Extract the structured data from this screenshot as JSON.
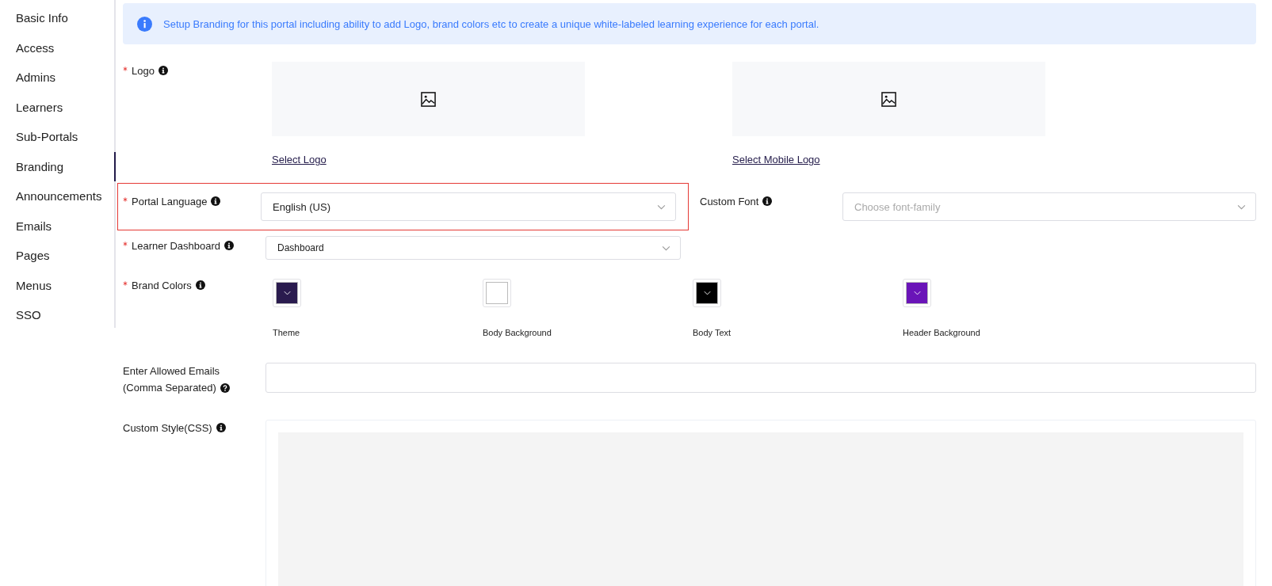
{
  "sidebar": {
    "items": [
      {
        "label": "Basic Info",
        "selected": false
      },
      {
        "label": "Access",
        "selected": false
      },
      {
        "label": "Admins",
        "selected": false
      },
      {
        "label": "Learners",
        "selected": false
      },
      {
        "label": "Sub-Portals",
        "selected": false
      },
      {
        "label": "Branding",
        "selected": true
      },
      {
        "label": "Announcements",
        "selected": false
      },
      {
        "label": "Emails",
        "selected": false
      },
      {
        "label": "Pages",
        "selected": false
      },
      {
        "label": "Menus",
        "selected": false
      },
      {
        "label": "SSO",
        "selected": false
      }
    ]
  },
  "info_banner": {
    "text": "Setup Branding for this portal including ability to add Logo, brand colors etc to create a unique white-labeled learning experience for each portal."
  },
  "logo": {
    "label": "Logo",
    "required": true,
    "help": {
      "kind": "info"
    },
    "uploads": [
      {
        "link": "Select Logo"
      },
      {
        "link": "Select Mobile Logo"
      }
    ]
  },
  "portal_language": {
    "label": "Portal Language",
    "required": true,
    "help": {
      "kind": "info"
    },
    "highlighted": true,
    "value": "English (US)"
  },
  "custom_font": {
    "label": "Custom Font",
    "required": false,
    "help": {
      "kind": "info"
    },
    "placeholder": "Choose font-family"
  },
  "learner_dashboard": {
    "label": "Learner Dashboard",
    "required": true,
    "help": {
      "kind": "info"
    },
    "value": "Dashboard"
  },
  "brand_colors": {
    "label": "Brand Colors",
    "required": true,
    "help": {
      "kind": "info"
    },
    "swatches": [
      {
        "label": "Theme",
        "color": "#2a1b4e"
      },
      {
        "label": "Body Background",
        "color": "#ffffff"
      },
      {
        "label": "Body Text",
        "color": "#000000"
      },
      {
        "label": "Header Background",
        "color": "#6a14b8"
      }
    ]
  },
  "allowed_emails": {
    "label_lines": [
      "Enter Allowed Emails",
      "(Comma Separated)"
    ],
    "required": false,
    "help": {
      "kind": "question"
    }
  },
  "custom_style": {
    "label": "Custom Style(CSS)",
    "required": false,
    "help": {
      "kind": "info"
    }
  }
}
